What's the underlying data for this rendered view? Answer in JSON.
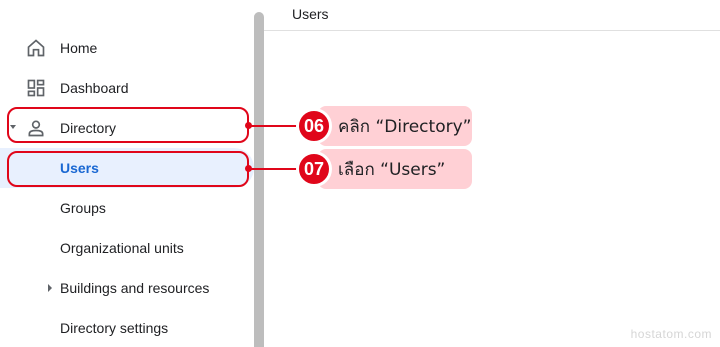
{
  "sidebar": {
    "items": [
      {
        "label": "Home",
        "icon": "home-icon"
      },
      {
        "label": "Dashboard",
        "icon": "dashboard-icon"
      },
      {
        "label": "Directory",
        "icon": "person-icon",
        "expanded": true
      },
      {
        "label": "Users",
        "active": true
      },
      {
        "label": "Groups"
      },
      {
        "label": "Organizational units"
      },
      {
        "label": "Buildings and resources",
        "collapsed": true
      },
      {
        "label": "Directory settings"
      }
    ]
  },
  "main": {
    "title": "Users"
  },
  "annotations": [
    {
      "number": "06",
      "text": "คลิก “Directory”"
    },
    {
      "number": "07",
      "text": "เลือก “Users”"
    }
  ],
  "colors": {
    "accent": "#e0061a",
    "callout_bg": "#ffd0d5",
    "active_bg": "#e8f0fe",
    "active_text": "#1967d2"
  },
  "watermark": "hostatom.com"
}
